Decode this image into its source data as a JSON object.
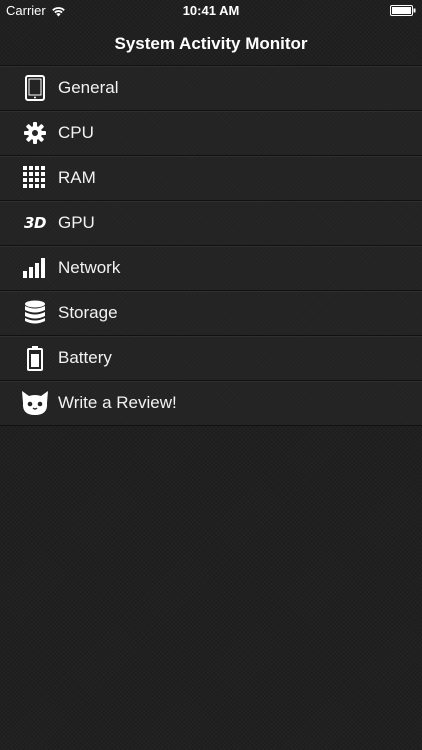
{
  "status_bar": {
    "carrier": "Carrier",
    "time": "10:41 AM",
    "wifi_icon": "wifi-icon",
    "battery_icon": "battery-full-icon"
  },
  "nav": {
    "title": "System Activity Monitor"
  },
  "menu": {
    "items": [
      {
        "label": "General",
        "icon": "tablet-icon"
      },
      {
        "label": "CPU",
        "icon": "gear-icon"
      },
      {
        "label": "RAM",
        "icon": "memory-grid-icon"
      },
      {
        "label": "GPU",
        "icon": "3d-icon",
        "icon_text": "3D"
      },
      {
        "label": "Network",
        "icon": "signal-bars-icon"
      },
      {
        "label": "Storage",
        "icon": "database-icon"
      },
      {
        "label": "Battery",
        "icon": "battery-icon"
      },
      {
        "label": "Write a Review!",
        "icon": "cat-face-icon"
      }
    ]
  },
  "colors": {
    "background": "#202020",
    "text": "#ffffff",
    "separator": "#111111"
  }
}
